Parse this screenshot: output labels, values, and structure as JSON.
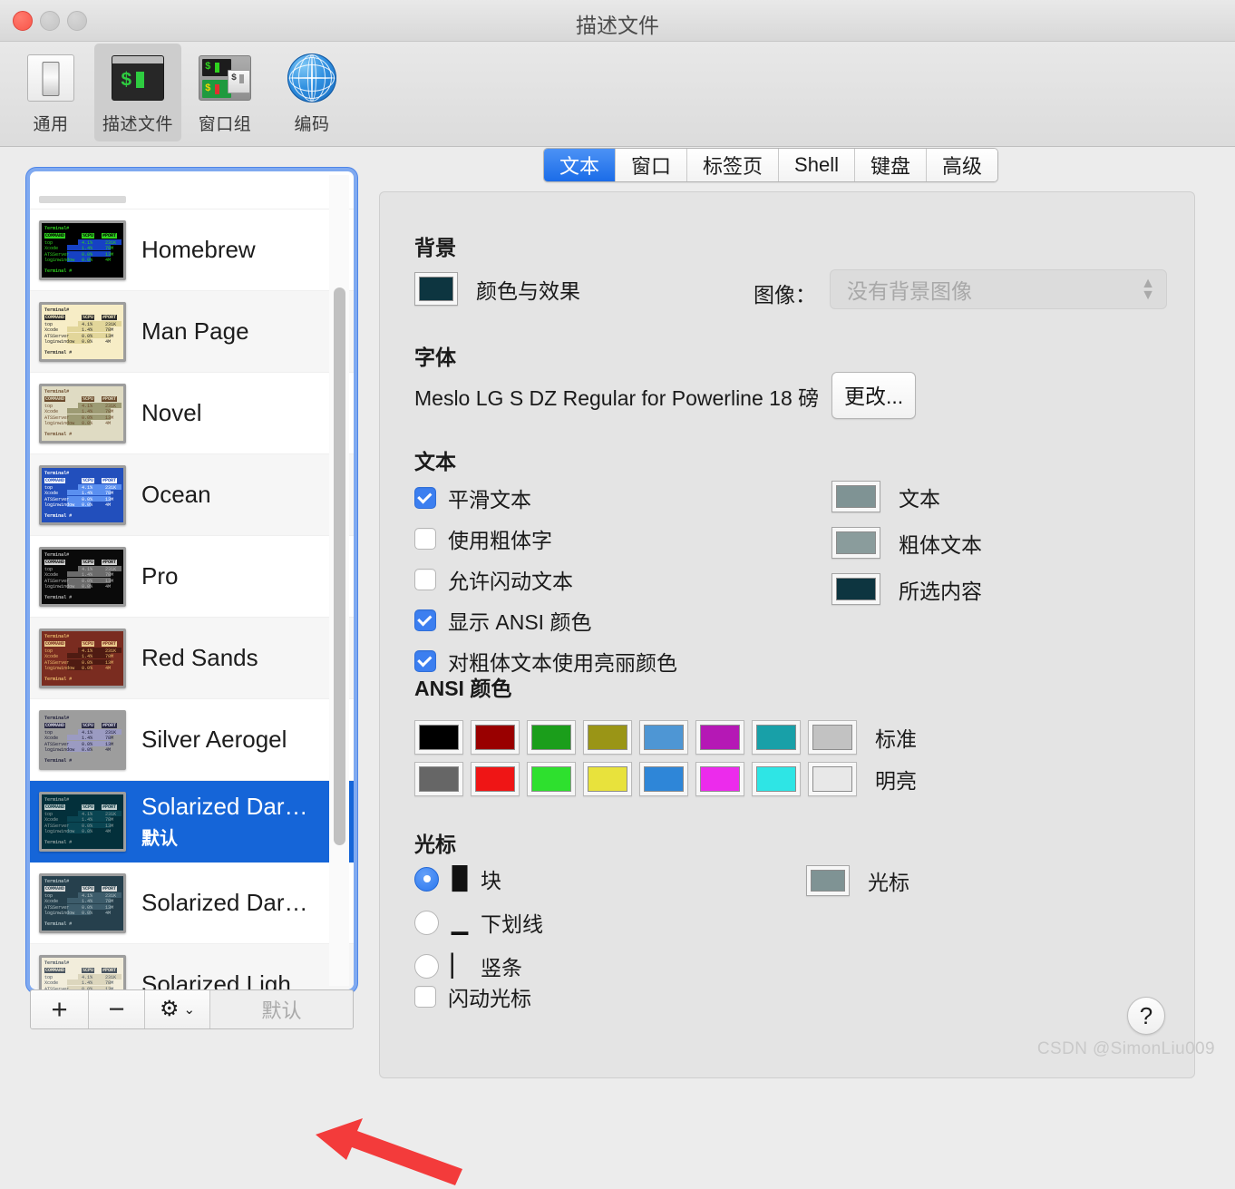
{
  "window": {
    "title": "描述文件",
    "traffic": [
      "close-button",
      "minimize-button",
      "maximize-button"
    ]
  },
  "toolbar": {
    "items": [
      {
        "label": "通用",
        "icon": "toggle-switch-icon",
        "active": false
      },
      {
        "label": "描述文件",
        "icon": "terminal-window-icon",
        "active": true
      },
      {
        "label": "窗口组",
        "icon": "window-group-icon",
        "active": false
      },
      {
        "label": "编码",
        "icon": "globe-icon",
        "active": false
      }
    ]
  },
  "sidebar": {
    "profiles": [
      {
        "name": "Homebrew",
        "subtitle": "",
        "selected": false,
        "theme": {
          "bg": "#000000",
          "fg": "#2fd21f",
          "sel": "#1641c4",
          "hdr": "#2fd21f",
          "hdrText": "#000000"
        }
      },
      {
        "name": "Man Page",
        "subtitle": "",
        "selected": false,
        "theme": {
          "bg": "#f7edc6",
          "fg": "#2b2b2b",
          "sel": "#e2d69a",
          "hdr": "#2b2b2b",
          "hdrText": "#f7edc6"
        }
      },
      {
        "name": "Novel",
        "subtitle": "",
        "selected": false,
        "theme": {
          "bg": "#dfdbc3",
          "fg": "#6b4a2c",
          "sel": "#9d9b74",
          "hdr": "#6b4a2c",
          "hdrText": "#dfdbc3"
        }
      },
      {
        "name": "Ocean",
        "subtitle": "",
        "selected": false,
        "theme": {
          "bg": "#224fbc",
          "fg": "#ffffff",
          "sel": "#5a8ff0",
          "hdr": "#ffffff",
          "hdrText": "#224fbc"
        }
      },
      {
        "name": "Pro",
        "subtitle": "",
        "selected": false,
        "theme": {
          "bg": "#0a0a0a",
          "fg": "#b9b9b9",
          "sel": "#6b6b6b",
          "hdr": "#cfcfcf",
          "hdrText": "#0a0a0a"
        }
      },
      {
        "name": "Red Sands",
        "subtitle": "",
        "selected": false,
        "theme": {
          "bg": "#7a2c20",
          "fg": "#e8b86a",
          "sel": "#4f1b12",
          "hdr": "#e8c98a",
          "hdrText": "#7a2c20"
        }
      },
      {
        "name": "Silver Aerogel",
        "subtitle": "",
        "selected": false,
        "theme": {
          "bg": "#9d9d9d",
          "fg": "#20203a",
          "sel": "#9b9bc2",
          "hdr": "#2a2a44",
          "hdrText": "#d6d6e4"
        }
      },
      {
        "name": "Solarized Dar…",
        "subtitle": "默认",
        "selected": true,
        "theme": {
          "bg": "#03303b",
          "fg": "#90a0a0",
          "sel": "#0a4552",
          "hdr": "#c2cfcf",
          "hdrText": "#03303b"
        }
      },
      {
        "name": "Solarized Dar…",
        "subtitle": "",
        "selected": false,
        "theme": {
          "bg": "#26404d",
          "fg": "#b3c2c6",
          "sel": "#3d5c6b",
          "hdr": "#dcdcdc",
          "hdrText": "#26404d"
        }
      },
      {
        "name": "Solarized Ligh…",
        "subtitle": "",
        "selected": false,
        "theme": {
          "bg": "#f2eddb",
          "fg": "#4a5560",
          "sel": "#dcd6bd",
          "hdr": "#4a5560",
          "hdrText": "#f2eddb"
        }
      }
    ],
    "thumb_lines": {
      "prompt": "Terminal#",
      "command_header": "COMMAND",
      "cpu_header": "%CPU",
      "mem_header": "#PORT",
      "rows": [
        {
          "proc": "top",
          "cpu": "4.1%",
          "mem": "231K"
        },
        {
          "proc": "Xcode",
          "cpu": "1.4%",
          "mem": "78M"
        },
        {
          "proc": "ATSServer",
          "cpu": "0.0%",
          "mem": "13M"
        },
        {
          "proc": "loginwindow",
          "cpu": "0.0%",
          "mem": "4M"
        }
      ],
      "footer": "Terminal #"
    },
    "toolbar": {
      "add_label": "+",
      "remove_label": "−",
      "gear_label": "⚙",
      "gear_chevron": "⌄",
      "default_label": "默认"
    }
  },
  "panel": {
    "tabs": [
      {
        "label": "文本",
        "active": true
      },
      {
        "label": "窗口",
        "active": false
      },
      {
        "label": "标签页",
        "active": false
      },
      {
        "label": "Shell",
        "active": false
      },
      {
        "label": "键盘",
        "active": false
      },
      {
        "label": "高级",
        "active": false
      }
    ],
    "background": {
      "heading": "背景",
      "color_effects_label": "颜色与效果",
      "background_swatch": "#0d3540",
      "image_label": "图像：",
      "image_value": "没有背景图像"
    },
    "font": {
      "heading": "字体",
      "value": "Meslo LG S DZ Regular for Powerline 18 磅",
      "change_button": "更改..."
    },
    "text": {
      "heading": "文本",
      "checkboxes": [
        {
          "label": "平滑文本",
          "checked": true
        },
        {
          "label": "使用粗体字",
          "checked": false
        },
        {
          "label": "允许闪动文本",
          "checked": false
        },
        {
          "label": "显示 ANSI 颜色",
          "checked": true
        },
        {
          "label": "对粗体文本使用亮丽颜色",
          "checked": true
        }
      ],
      "color_wells": [
        {
          "label": "文本",
          "color": "#7f9394"
        },
        {
          "label": "粗体文本",
          "color": "#8a9c9c"
        },
        {
          "label": "所选内容",
          "color": "#0d3540"
        }
      ]
    },
    "ansi": {
      "heading": "ANSI 颜色",
      "normal_label": "标准",
      "bright_label": "明亮",
      "normal": [
        "#000000",
        "#990000",
        "#1b9e1b",
        "#9a9516",
        "#4e96d4",
        "#b518b5",
        "#18a0a8",
        "#c2c2c2"
      ],
      "bright": [
        "#666666",
        "#ef1515",
        "#2ee02e",
        "#e8e23c",
        "#2e86d8",
        "#ec2bec",
        "#2ee5e5",
        "#e8e8e8"
      ]
    },
    "cursor": {
      "heading": "光标",
      "options": [
        {
          "label": "块",
          "glyph": "█",
          "selected": true
        },
        {
          "label": "下划线",
          "glyph": "▁",
          "selected": false
        },
        {
          "label": "竖条",
          "glyph": "▏",
          "selected": false
        }
      ],
      "blink_label": "闪动光标",
      "blink_checked": false,
      "color_well": {
        "label": "光标",
        "color": "#7f9394"
      }
    },
    "help_label": "?"
  },
  "annotation": {
    "arrow_color": "#f33b3b"
  },
  "watermark": "CSDN @SimonLiu009"
}
